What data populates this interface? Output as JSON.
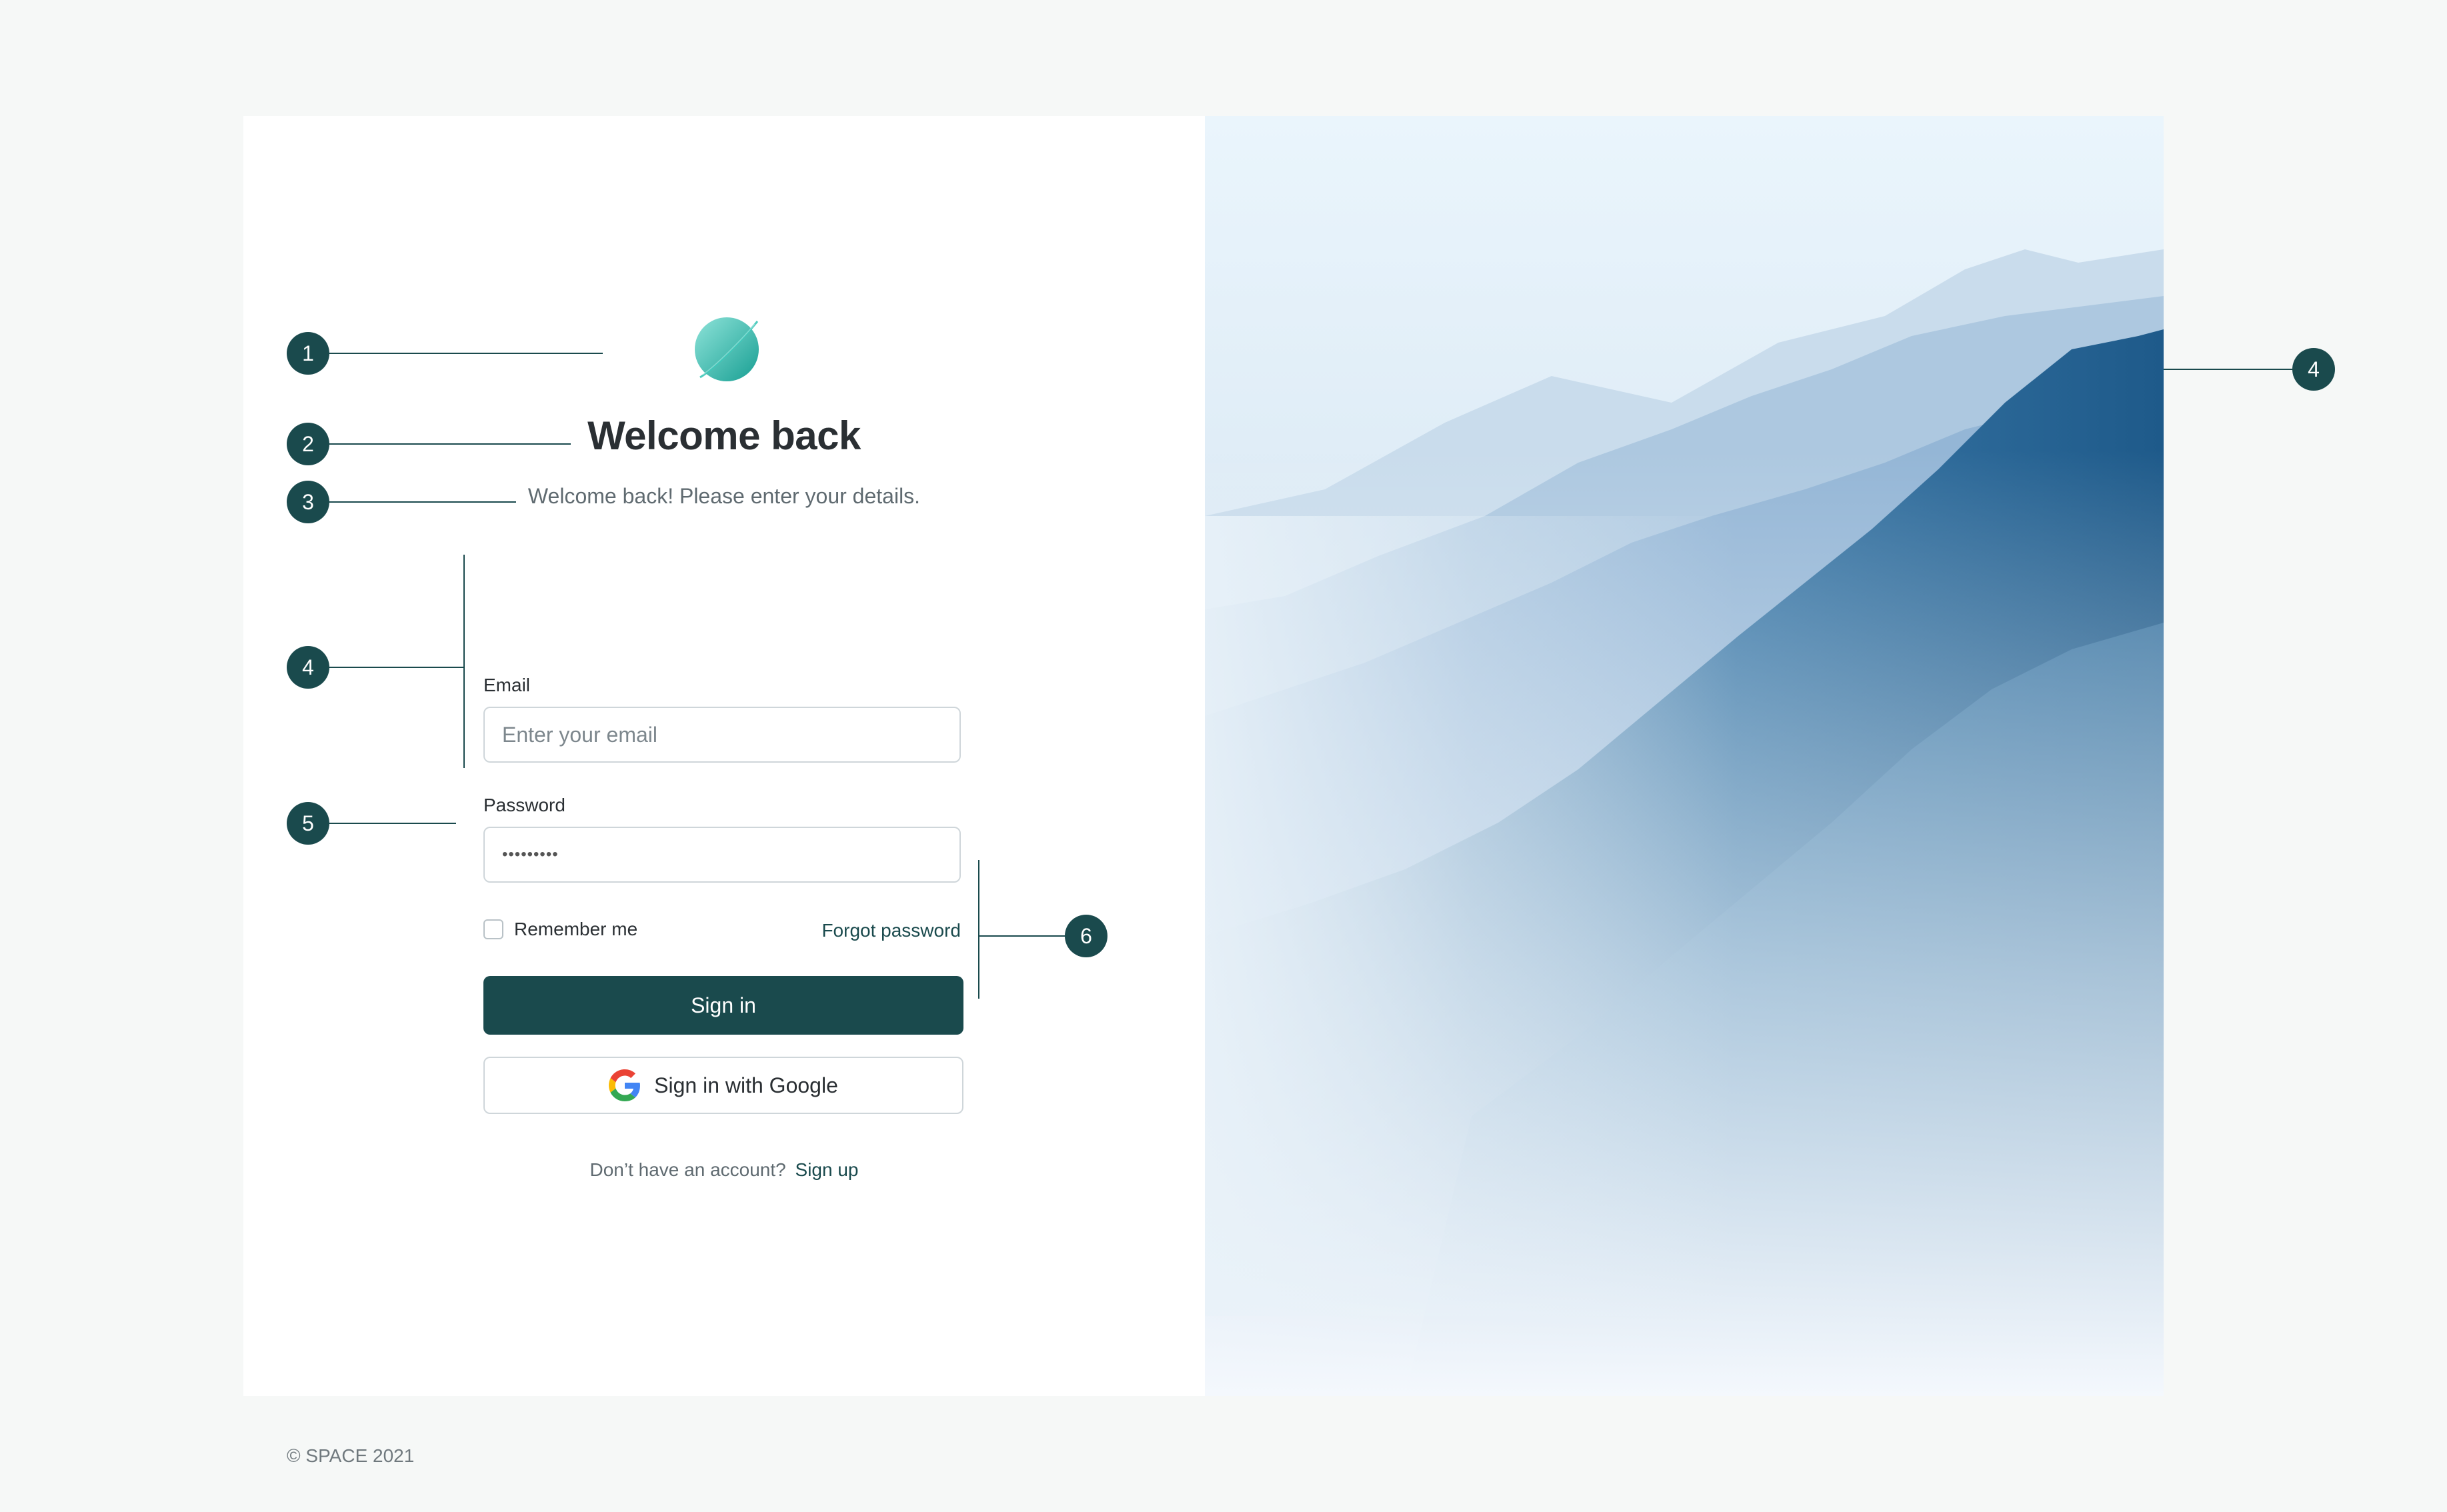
{
  "brand": {
    "logo_icon": "planet-icon",
    "accent_color": "#1a4a4d",
    "logo_gradient": [
      "#7fd8cf",
      "#1ba89a"
    ]
  },
  "login": {
    "title": "Welcome back",
    "subtitle": "Welcome back! Please enter your details.",
    "email": {
      "label": "Email",
      "placeholder": "Enter your email",
      "value": ""
    },
    "password": {
      "label": "Password",
      "value": "•••••••••"
    },
    "remember_label": "Remember me",
    "remember_checked": false,
    "forgot_label": "Forgot password",
    "signin_label": "Sign in",
    "google_label": "Sign in with Google",
    "google_icon": "google-icon",
    "signup_prompt": "Don’t have an account?",
    "signup_link": "Sign up"
  },
  "footer": {
    "copyright": "© SPACE 2021"
  },
  "hero": {
    "image_icon": "mountain-landscape"
  },
  "annotations": {
    "m1": "1",
    "m2": "2",
    "m3": "3",
    "m4": "4",
    "m4b": "4",
    "m5": "5",
    "m6": "6"
  }
}
